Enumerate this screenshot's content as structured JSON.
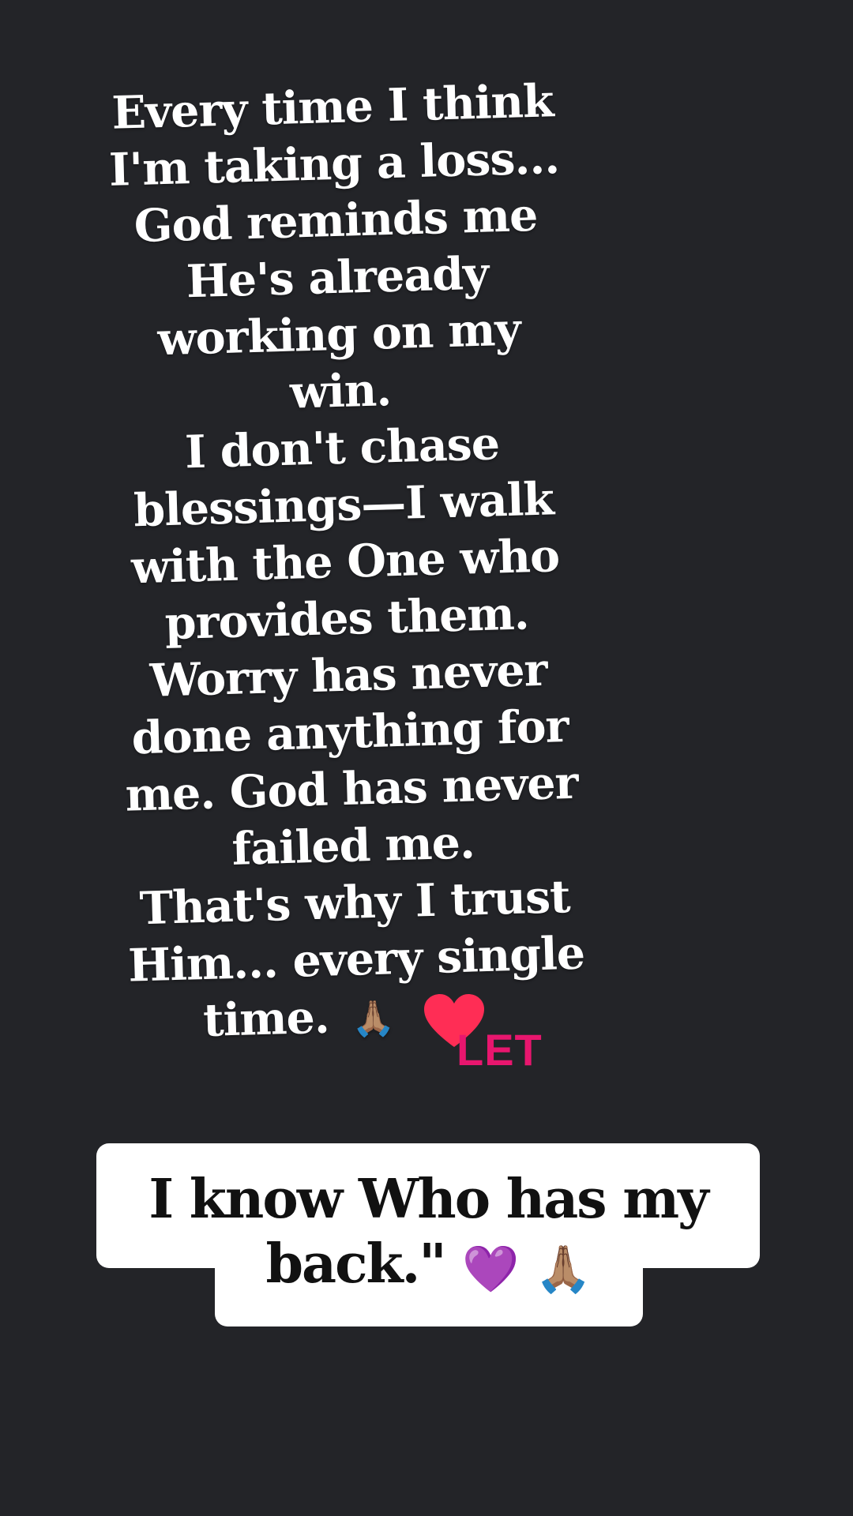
{
  "story": {
    "quote_lines": [
      "Every time I think",
      "I'm taking a loss...",
      "God reminds me",
      "He's already",
      "working on my",
      "win.",
      "I don't chase",
      "blessings—I walk",
      "with the One who",
      "provides them.",
      "Worry has never",
      "done anything for",
      "me. God has never",
      "failed me.",
      "That's why I trust",
      "Him... every single",
      "time."
    ],
    "quote_end_emoji": "🙏🏽",
    "sticker_word": "LET",
    "caption": {
      "line1": "I know Who has my",
      "line2": "back.\"",
      "emoji_heart": "💜",
      "emoji_pray": "🙏🏽"
    }
  },
  "colors": {
    "background": "#232428",
    "quote_text": "#ffffff",
    "caption_bg": "#ffffff",
    "caption_text": "#111111",
    "heart": "#ff2d55",
    "sticker_text": "#e8166e"
  }
}
